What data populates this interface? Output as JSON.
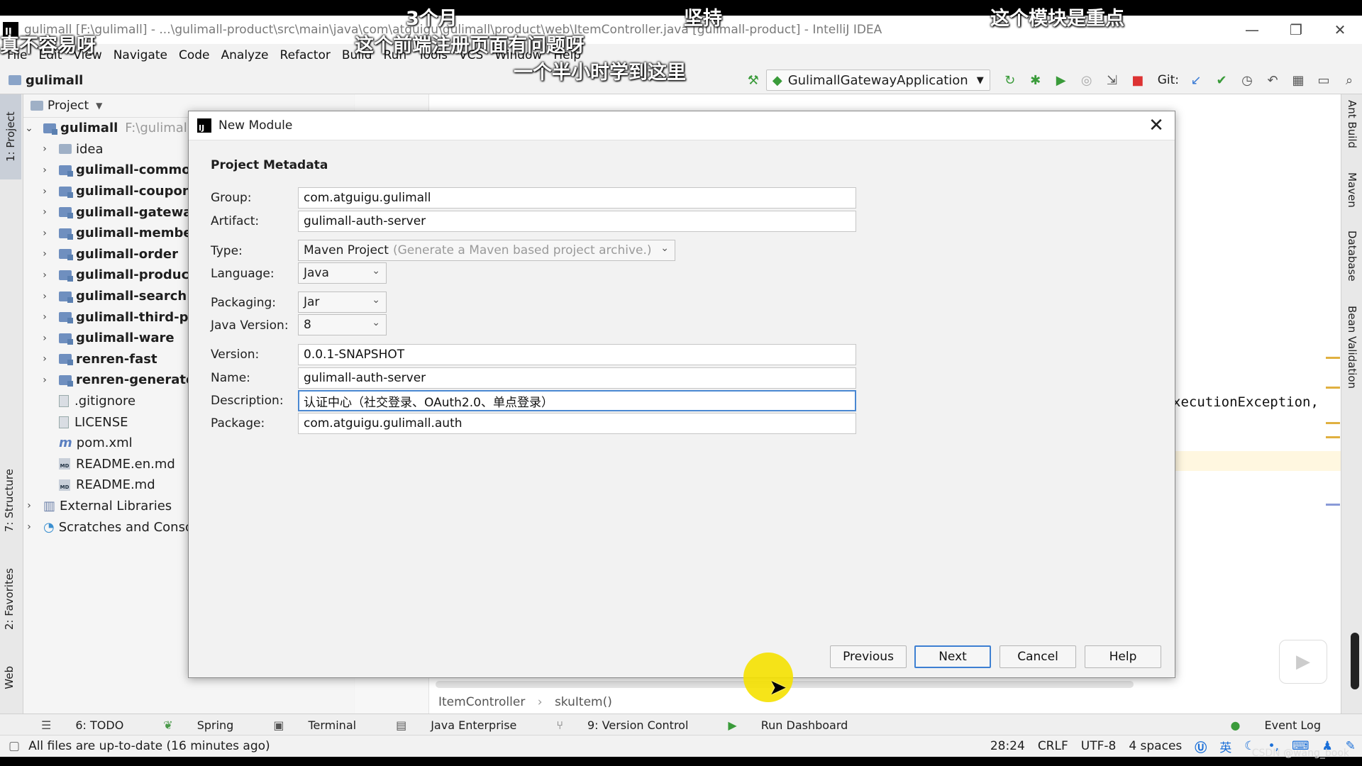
{
  "window": {
    "title": "gulimall [F:\\gulimall] - ...\\gulimall-product\\src\\main\\java\\com\\atguigu\\gulimall\\product\\web\\ItemController.java [gulimall-product] - IntelliJ IDEA",
    "logo_text": "IJ"
  },
  "menu": [
    "File",
    "Edit",
    "View",
    "Navigate",
    "Code",
    "Analyze",
    "Refactor",
    "Build",
    "Run",
    "Tools",
    "VCS",
    "Window",
    "Help"
  ],
  "nav": {
    "project": "gulimall",
    "run_config": "GulimallGatewayApplication",
    "git_label": "Git:"
  },
  "left_tabs": {
    "project": "1: Project",
    "structure": "7: Structure",
    "favorites": "2: Favorites",
    "web": "Web"
  },
  "right_tabs": [
    "Ant Build",
    "Maven",
    "Database",
    "Bean Validation"
  ],
  "project_panel": {
    "header": "Project",
    "root_name": "gulimall",
    "root_path": "F:\\gulimall",
    "items": [
      {
        "label": "idea",
        "type": "folder"
      },
      {
        "label": "gulimall-common",
        "type": "module"
      },
      {
        "label": "gulimall-coupon",
        "type": "module"
      },
      {
        "label": "gulimall-gateway",
        "type": "module"
      },
      {
        "label": "gulimall-member",
        "type": "module"
      },
      {
        "label": "gulimall-order",
        "type": "module"
      },
      {
        "label": "gulimall-product",
        "type": "module"
      },
      {
        "label": "gulimall-search",
        "type": "module"
      },
      {
        "label": "gulimall-third-party",
        "type": "module"
      },
      {
        "label": "gulimall-ware",
        "type": "module"
      },
      {
        "label": "renren-fast",
        "type": "module"
      },
      {
        "label": "renren-generator",
        "type": "module"
      }
    ],
    "files": [
      {
        "label": ".gitignore",
        "type": "file"
      },
      {
        "label": "LICENSE",
        "type": "file"
      },
      {
        "label": "pom.xml",
        "type": "maven"
      },
      {
        "label": "README.en.md",
        "type": "md"
      },
      {
        "label": "README.md",
        "type": "md"
      }
    ],
    "external": "External Libraries",
    "scratches": "Scratches and Consoles"
  },
  "editor": {
    "code_fragment": "xecutionException,",
    "breadcrumb": [
      "ItemController",
      "skuItem()"
    ]
  },
  "dialog": {
    "title": "New Module",
    "section": "Project Metadata",
    "fields": {
      "group": {
        "label": "Group:",
        "value": "com.atguigu.gulimall"
      },
      "artifact": {
        "label": "Artifact:",
        "value": "gulimall-auth-server"
      },
      "type": {
        "label": "Type:",
        "value": "Maven Project",
        "hint": "(Generate a Maven based project archive.)"
      },
      "language": {
        "label": "Language:",
        "value": "Java"
      },
      "packaging": {
        "label": "Packaging:",
        "value": "Jar"
      },
      "java_version": {
        "label": "Java Version:",
        "value": "8"
      },
      "version": {
        "label": "Version:",
        "value": "0.0.1-SNAPSHOT"
      },
      "name": {
        "label": "Name:",
        "value": "gulimall-auth-server"
      },
      "description": {
        "label": "Description:",
        "value": "认证中心（社交登录、OAuth2.0、单点登录）"
      },
      "package": {
        "label": "Package:",
        "value": "com.atguigu.gulimall.auth"
      }
    },
    "buttons": {
      "previous": "Previous",
      "next": "Next",
      "cancel": "Cancel",
      "help": "Help"
    }
  },
  "bottom_tools": [
    "6: TODO",
    "Spring",
    "Terminal",
    "Java Enterprise",
    "9: Version Control",
    "Run Dashboard"
  ],
  "event_log": "Event Log",
  "status": {
    "message": "All files are up-to-date (16 minutes ago)",
    "position": "28:24",
    "line_sep": "CRLF",
    "encoding": "UTF-8",
    "indent": "4 spaces",
    "ime": "英"
  },
  "overlay_subtitles": [
    "3个月",
    "坚持",
    "这个模块是重点",
    "真不容易呀",
    "这个前端注册页面有问题呀",
    "一个半小时学到这里"
  ],
  "watermark": "CSDN @wang_book"
}
